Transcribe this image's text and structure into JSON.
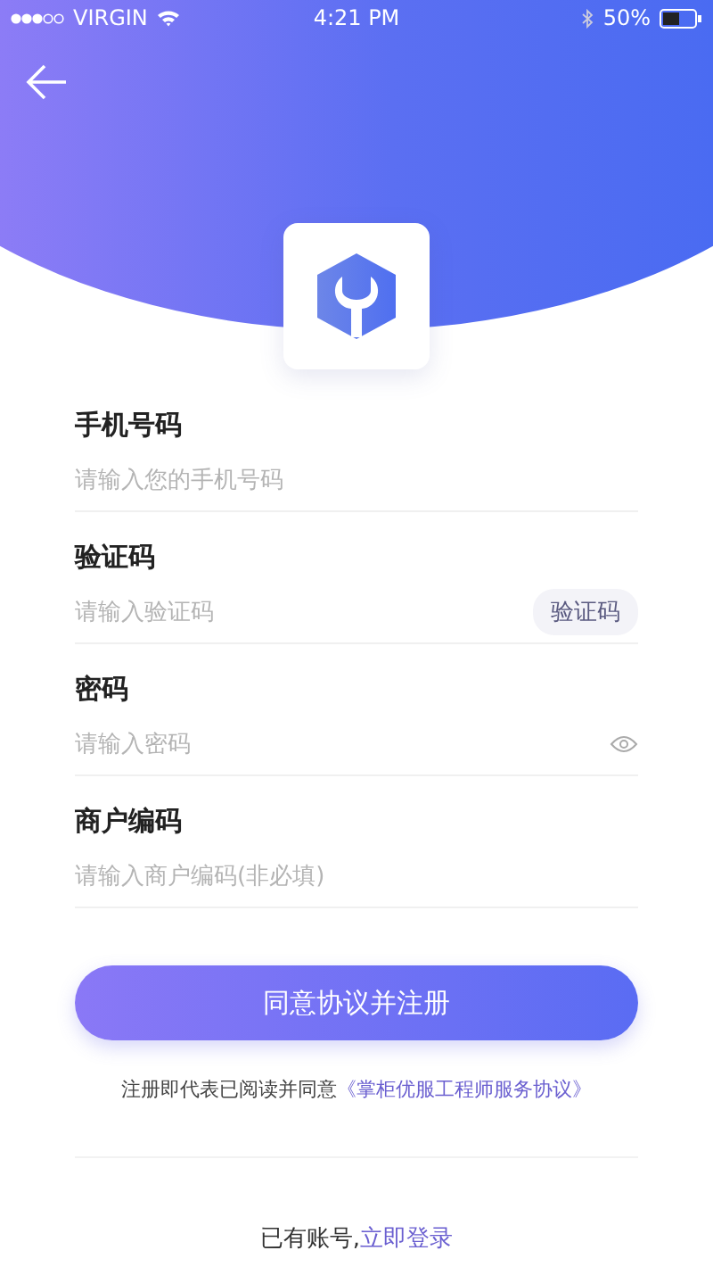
{
  "status_bar": {
    "carrier": "VIRGIN",
    "time": "4:21 PM",
    "battery": "50%"
  },
  "fields": [
    {
      "kind": "text",
      "label": "手机号码",
      "placeholder": "请输入您的手机号码"
    },
    {
      "kind": "code",
      "label": "验证码",
      "placeholder": "请输入验证码",
      "button": "验证码"
    },
    {
      "kind": "password",
      "label": "密码",
      "placeholder": "请输入密码"
    },
    {
      "kind": "text",
      "label": "商户编码",
      "placeholder": "请输入商户编码(非必填)"
    }
  ],
  "submit": "同意协议并注册",
  "agreement": {
    "text": "注册即代表已阅读并同意",
    "link": "《掌柜优服工程师服务协议》"
  },
  "login": {
    "text": "已有账号,",
    "link": "立即登录"
  }
}
